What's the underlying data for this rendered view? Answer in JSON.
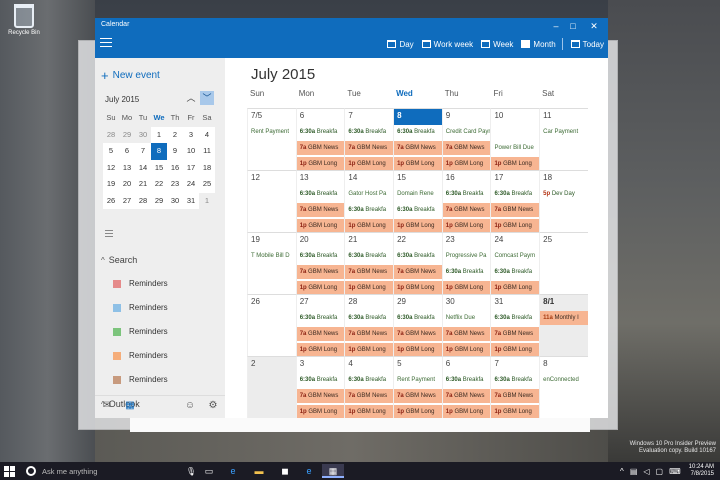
{
  "desktop": {
    "recycle_bin": "Recycle Bin",
    "watermark_line1": "Windows 10 Pro Insider Preview",
    "watermark_line2": "Evaluation copy. Build 10167"
  },
  "window": {
    "title": "Calendar",
    "minimize": "–",
    "maximize": "□",
    "close": "✕",
    "accent_color": "#0f6cbd"
  },
  "toolbar": {
    "views": [
      {
        "label": "Day",
        "icon": "day-icon"
      },
      {
        "label": "Work week",
        "icon": "workweek-icon"
      },
      {
        "label": "Week",
        "icon": "week-icon"
      },
      {
        "label": "Month",
        "icon": "month-icon",
        "active": true
      },
      {
        "label": "Today",
        "icon": "today-icon"
      }
    ]
  },
  "sidebar": {
    "new_event": "New event",
    "mini_month_title": "July 2015",
    "weekday_headers": [
      "Su",
      "Mo",
      "Tu",
      "We",
      "Th",
      "Fr",
      "Sa"
    ],
    "weeks": [
      [
        "28",
        "29",
        "30",
        "1",
        "2",
        "3",
        "4"
      ],
      [
        "5",
        "6",
        "7",
        "8",
        "9",
        "10",
        "11"
      ],
      [
        "12",
        "13",
        "14",
        "15",
        "16",
        "17",
        "18"
      ],
      [
        "19",
        "20",
        "21",
        "22",
        "23",
        "24",
        "25"
      ],
      [
        "26",
        "27",
        "28",
        "29",
        "30",
        "31",
        "1"
      ]
    ],
    "search_label": "Search",
    "calendars": [
      {
        "label": "Reminders",
        "color": "#e58a8a"
      },
      {
        "label": "Reminders",
        "color": "#8ec0e6"
      },
      {
        "label": "Reminders",
        "color": "#7cc47c"
      },
      {
        "label": "Reminders",
        "color": "#f5ad7a"
      },
      {
        "label": "Reminders",
        "color": "#c79a7e"
      }
    ],
    "outlook_label": "Outlook"
  },
  "main": {
    "month_title": "July 2015",
    "weekday_headers": [
      "Sun",
      "Mon",
      "Tue",
      "Wed",
      "Thu",
      "Fri",
      "Sat"
    ],
    "weeks": [
      [
        {
          "num": "7/5",
          "events": [
            {
              "text": "Rent Payment",
              "style": "plain"
            }
          ]
        },
        {
          "num": "6",
          "events": [
            {
              "time": "6:30a",
              "text": "Breakfa"
            },
            {
              "time": "7a",
              "text": "GBM News",
              "style": "peach"
            },
            {
              "time": "1p",
              "text": "GBM Long",
              "style": "peach"
            }
          ]
        },
        {
          "num": "7",
          "events": [
            {
              "time": "6:30a",
              "text": "Breakfa"
            },
            {
              "time": "7a",
              "text": "GBM News",
              "style": "peach"
            },
            {
              "time": "1p",
              "text": "GBM Long",
              "style": "peach"
            }
          ]
        },
        {
          "num": "8",
          "today": true,
          "events": [
            {
              "time": "6:30a",
              "text": "Breakfa"
            },
            {
              "time": "7a",
              "text": "GBM News",
              "style": "peach"
            },
            {
              "time": "1p",
              "text": "GBM Long",
              "style": "peach"
            }
          ]
        },
        {
          "num": "9",
          "events": [
            {
              "text": "Credit Card Payment",
              "style": "plain"
            },
            {
              "time": "7a",
              "text": "GBM News",
              "style": "peach"
            },
            {
              "time": "1p",
              "text": "GBM Long",
              "style": "peach"
            }
          ]
        },
        {
          "num": "10",
          "events": [
            {
              "text": "",
              "style": "plain"
            },
            {
              "text": "Power Bill Due",
              "style": "plain"
            },
            {
              "time": "1p",
              "text": "GBM Long",
              "style": "peach"
            }
          ]
        },
        {
          "num": "11",
          "events": [
            {
              "text": "Car Payment",
              "style": "plain"
            }
          ]
        }
      ],
      [
        {
          "num": "12",
          "events": []
        },
        {
          "num": "13",
          "events": [
            {
              "time": "6:30a",
              "text": "Breakfa"
            },
            {
              "time": "7a",
              "text": "GBM News",
              "style": "peach"
            },
            {
              "time": "1p",
              "text": "GBM Long",
              "style": "peach"
            }
          ]
        },
        {
          "num": "14",
          "events": [
            {
              "text": "Gator Host Pa",
              "style": "plain"
            },
            {
              "time": "6:30a",
              "text": "Breakfa"
            },
            {
              "time": "1p",
              "text": "GBM Long",
              "style": "peach"
            }
          ]
        },
        {
          "num": "15",
          "events": [
            {
              "text": "Domain Rene",
              "style": "plain"
            },
            {
              "time": "6:30a",
              "text": "Breakfa"
            },
            {
              "time": "1p",
              "text": "GBM Long",
              "style": "peach"
            }
          ]
        },
        {
          "num": "16",
          "events": [
            {
              "time": "6:30a",
              "text": "Breakfa"
            },
            {
              "time": "7a",
              "text": "GBM News",
              "style": "peach"
            },
            {
              "time": "1p",
              "text": "GBM Long",
              "style": "peach"
            }
          ]
        },
        {
          "num": "17",
          "events": [
            {
              "time": "6:30a",
              "text": "Breakfa"
            },
            {
              "time": "7a",
              "text": "GBM News",
              "style": "peach"
            },
            {
              "time": "1p",
              "text": "GBM Long",
              "style": "peach"
            }
          ]
        },
        {
          "num": "18",
          "events": [
            {
              "time": "5p",
              "text": "Dev Day",
              "style": "red"
            }
          ]
        }
      ],
      [
        {
          "num": "19",
          "events": [
            {
              "text": "T Mobile Bill D",
              "style": "plain"
            }
          ]
        },
        {
          "num": "20",
          "events": [
            {
              "time": "6:30a",
              "text": "Breakfa"
            },
            {
              "time": "7a",
              "text": "GBM News",
              "style": "peach"
            },
            {
              "time": "1p",
              "text": "GBM Long",
              "style": "peach"
            }
          ]
        },
        {
          "num": "21",
          "events": [
            {
              "time": "6:30a",
              "text": "Breakfa"
            },
            {
              "time": "7a",
              "text": "GBM News",
              "style": "peach"
            },
            {
              "time": "1p",
              "text": "GBM Long",
              "style": "peach"
            }
          ]
        },
        {
          "num": "22",
          "events": [
            {
              "time": "6:30a",
              "text": "Breakfa"
            },
            {
              "time": "7a",
              "text": "GBM News",
              "style": "peach"
            },
            {
              "time": "1p",
              "text": "GBM Long",
              "style": "peach"
            }
          ]
        },
        {
          "num": "23",
          "events": [
            {
              "text": "Progressive Pa",
              "style": "plain"
            },
            {
              "time": "6:30a",
              "text": "Breakfa"
            },
            {
              "time": "1p",
              "text": "GBM Long",
              "style": "peach"
            }
          ]
        },
        {
          "num": "24",
          "events": [
            {
              "text": "Comcast Paym",
              "style": "plain"
            },
            {
              "time": "6:30a",
              "text": "Breakfa"
            },
            {
              "time": "1p",
              "text": "GBM Long",
              "style": "peach"
            }
          ]
        },
        {
          "num": "25",
          "events": []
        }
      ],
      [
        {
          "num": "26",
          "events": []
        },
        {
          "num": "27",
          "events": [
            {
              "time": "6:30a",
              "text": "Breakfa"
            },
            {
              "time": "7a",
              "text": "GBM News",
              "style": "peach"
            },
            {
              "time": "1p",
              "text": "GBM Long",
              "style": "peach"
            }
          ]
        },
        {
          "num": "28",
          "events": [
            {
              "time": "6:30a",
              "text": "Breakfa"
            },
            {
              "time": "7a",
              "text": "GBM News",
              "style": "peach"
            },
            {
              "time": "1p",
              "text": "GBM Long",
              "style": "peach"
            }
          ]
        },
        {
          "num": "29",
          "events": [
            {
              "time": "6:30a",
              "text": "Breakfa"
            },
            {
              "time": "7a",
              "text": "GBM News",
              "style": "peach"
            },
            {
              "time": "1p",
              "text": "GBM Long",
              "style": "peach"
            }
          ]
        },
        {
          "num": "30",
          "events": [
            {
              "text": "Netflix Due",
              "style": "plain"
            },
            {
              "time": "7a",
              "text": "GBM News",
              "style": "peach"
            },
            {
              "time": "1p",
              "text": "GBM Long",
              "style": "peach"
            }
          ]
        },
        {
          "num": "31",
          "events": [
            {
              "time": "6:30a",
              "text": "Breakfa"
            },
            {
              "time": "7a",
              "text": "GBM News",
              "style": "peach"
            },
            {
              "time": "1p",
              "text": "GBM Long",
              "style": "peach"
            }
          ]
        },
        {
          "num": "8/1",
          "grey": true,
          "bold": true,
          "events": [
            {
              "time": "11a",
              "text": "Monthly I",
              "style": "orange"
            }
          ]
        }
      ],
      [
        {
          "num": "2",
          "grey": true,
          "events": []
        },
        {
          "num": "3",
          "events": [
            {
              "time": "6:30a",
              "text": "Breakfa"
            },
            {
              "time": "7a",
              "text": "GBM News",
              "style": "peach"
            },
            {
              "time": "1p",
              "text": "GBM Long",
              "style": "peach"
            }
          ]
        },
        {
          "num": "4",
          "events": [
            {
              "time": "6:30a",
              "text": "Breakfa"
            },
            {
              "time": "7a",
              "text": "GBM News",
              "style": "peach"
            },
            {
              "time": "1p",
              "text": "GBM Long",
              "style": "peach"
            }
          ]
        },
        {
          "num": "5",
          "events": [
            {
              "text": "Rent Payment",
              "style": "plain"
            },
            {
              "time": "7a",
              "text": "GBM News",
              "style": "peach"
            },
            {
              "time": "1p",
              "text": "GBM Long",
              "style": "peach"
            }
          ]
        },
        {
          "num": "6",
          "events": [
            {
              "time": "6:30a",
              "text": "Breakfa"
            },
            {
              "time": "7a",
              "text": "GBM News",
              "style": "peach"
            },
            {
              "time": "1p",
              "text": "GBM Long",
              "style": "peach"
            }
          ]
        },
        {
          "num": "7",
          "events": [
            {
              "time": "6:30a",
              "text": "Breakfa"
            },
            {
              "time": "7a",
              "text": "GBM News",
              "style": "peach"
            },
            {
              "time": "1p",
              "text": "GBM Long",
              "style": "peach"
            }
          ]
        },
        {
          "num": "8",
          "events": [
            {
              "text": "enConnected",
              "style": "plain"
            }
          ]
        }
      ]
    ]
  },
  "taskbar": {
    "search_placeholder": "Ask me anything",
    "time": "10:24 AM",
    "date": "7/8/2015"
  }
}
